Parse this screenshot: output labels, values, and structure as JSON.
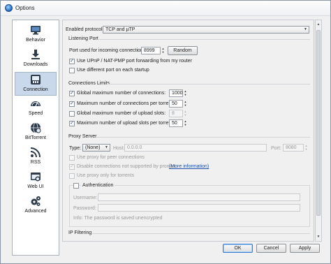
{
  "window": {
    "title": "Options"
  },
  "sidebar": {
    "items": [
      {
        "label": "Behavior",
        "icon": "monitor-icon"
      },
      {
        "label": "Downloads",
        "icon": "download-arrow-icon"
      },
      {
        "label": "Connection",
        "icon": "network-icon",
        "selected": true
      },
      {
        "label": "Speed",
        "icon": "speedometer-icon"
      },
      {
        "label": "BitTorrent",
        "icon": "globe-icon"
      },
      {
        "label": "RSS",
        "icon": "rss-icon"
      },
      {
        "label": "Web UI",
        "icon": "web-ui-icon"
      },
      {
        "label": "Advanced",
        "icon": "gears-icon"
      }
    ]
  },
  "connection": {
    "enabled_protocol_label": "Enabled protocol:",
    "enabled_protocol_value": "TCP and µTP",
    "listening_port": {
      "title": "Listening Port",
      "port_label": "Port used for incoming connections:",
      "port_value": "8999",
      "random_button": "Random",
      "upnp_label": "Use UPnP / NAT-PMP port forwarding from my router",
      "upnp_checked": true,
      "different_port_label": "Use different port on each startup",
      "different_port_checked": false
    },
    "limits": {
      "title": "Connections Limits",
      "rows": [
        {
          "label": "Global maximum number of connections:",
          "value": "1000",
          "checked": true
        },
        {
          "label": "Maximum number of connections per torrent:",
          "value": "50",
          "checked": true
        },
        {
          "label": "Global maximum number of upload slots:",
          "value": "8",
          "checked": false
        },
        {
          "label": "Maximum number of upload slots per torrent:",
          "value": "50",
          "checked": true
        }
      ]
    },
    "proxy": {
      "title": "Proxy Server",
      "type_label": "Type:",
      "type_value": "(None)",
      "host_label": "Host:",
      "host_value": "0.0.0.0",
      "port_label": "Port:",
      "port_value": "8080",
      "peer_label": "Use proxy for peer connections",
      "peer_checked": false,
      "disable_unsupported_label": "Disable connections not supported by proxies",
      "disable_unsupported_checked": true,
      "more_info": "(More information)",
      "torrents_only_label": "Use proxy only for torrents",
      "torrents_only_checked": false,
      "auth_label": "Authentication",
      "auth_checked": false,
      "username_label": "Username:",
      "username_value": "",
      "password_label": "Password:",
      "password_value": "",
      "info_text": "Info: The password is saved unencrypted"
    },
    "ip_filtering": {
      "title": "IP Filtering"
    }
  },
  "footer": {
    "ok": "OK",
    "cancel": "Cancel",
    "apply": "Apply"
  }
}
